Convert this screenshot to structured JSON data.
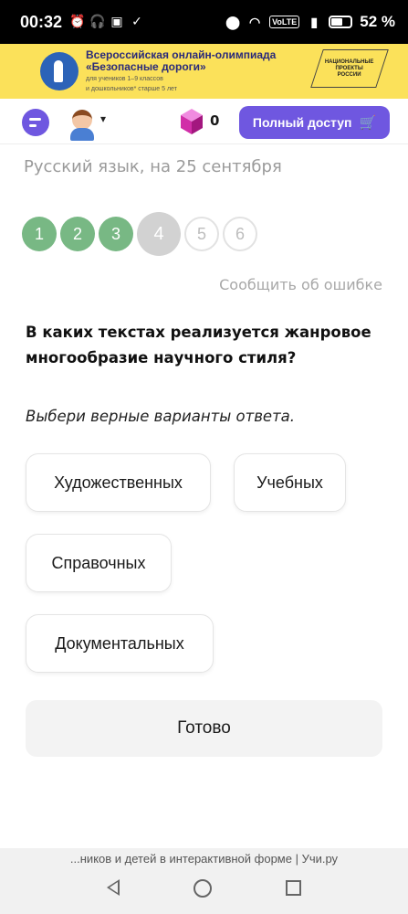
{
  "status": {
    "time": "00:32",
    "volte": "VoLTE",
    "battery": "52 %"
  },
  "banner": {
    "title_line1": "Всероссийская онлайн-олимпиада",
    "title_line2": "«Безопасные дороги»",
    "sub_line1": "для учеников 1–9 классов",
    "sub_line2": "и дошкольников* старше 5 лет",
    "nat_line1": "НАЦИОНАЛЬНЫЕ",
    "nat_line2": "ПРОЕКТЫ",
    "nat_line3": "РОССИИ"
  },
  "topbar": {
    "coins": "0",
    "full_access_label": "Полный доступ"
  },
  "subject": "Русский язык, на 25 сентября",
  "steps": [
    {
      "label": "1",
      "state": "done"
    },
    {
      "label": "2",
      "state": "done"
    },
    {
      "label": "3",
      "state": "done"
    },
    {
      "label": "4",
      "state": "current"
    },
    {
      "label": "5",
      "state": "todo"
    },
    {
      "label": "6",
      "state": "todo"
    }
  ],
  "report_error": "Сообщить об ошибке",
  "question": "В каких текстах реализуется жанровое многообразие научного стиля?",
  "hint": "Выбери верные варианты ответа.",
  "options": [
    "Художественных",
    "Учебных",
    "Справочных",
    "Документальных"
  ],
  "done_label": "Готово",
  "footer_text": "...ников и детей в интерактивной форме | Учи.ру",
  "colors": {
    "accent": "#6f57e0",
    "done_step": "#78b884",
    "banner_bg": "#fbe15a"
  }
}
